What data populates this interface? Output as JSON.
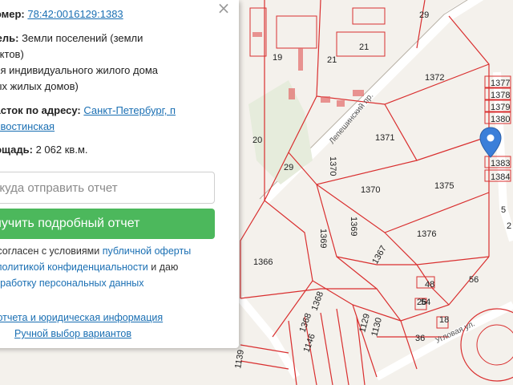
{
  "panel": {
    "close_icon": "×",
    "cadastral_label": "номер:",
    "cadastral_value": "78:42:0016129:1383",
    "land_label": "мель:",
    "land_value": "Земли поселений (земли",
    "land_line2": "унктов)",
    "use_line1": "ния индивидуального жилого дома",
    "use_line2": "ных жилых домов)",
    "address_label": "часток по адресу:",
    "address_value": "Санкт-Петербург, п",
    "address_line2": "ровостинская",
    "area_label": "лощадь:",
    "area_value": "2 062 кв.м.",
    "email_placeholder": ", куда отправить отчет",
    "report_button": "олучить подробный отчет",
    "agree_part1": "н согласен с условиями ",
    "agree_link1": "публичной оферты",
    "agree_part2": "с ",
    "agree_link2": "политикой конфиденциальности",
    "agree_part3": " и даю",
    "agree_link3": "обработку персональных данных",
    "legal_link": "и отчета и юридическая информация",
    "manual_link": "Ручной выбор вариантов"
  },
  "map": {
    "parcels": [
      "1372",
      "1377",
      "1378",
      "1379",
      "1380",
      "1383",
      "1384",
      "1371",
      "1375",
      "1370",
      "1370",
      "1369",
      "1369",
      "1376",
      "1366",
      "1367",
      "1368",
      "1368",
      "1129",
      "1130",
      "1146",
      "1139",
      "21",
      "21",
      "19",
      "20",
      "29",
      "29",
      "26",
      "48",
      "56",
      "54",
      "18",
      "36",
      "5",
      "2"
    ],
    "street_labels": [
      "Лепешинский пр.",
      "Угловая ул."
    ],
    "colors": {
      "parcel_line": "#d92f2f",
      "background": "#f4f1ec",
      "road": "#ffffff",
      "marker": "#3b7fd9"
    }
  }
}
